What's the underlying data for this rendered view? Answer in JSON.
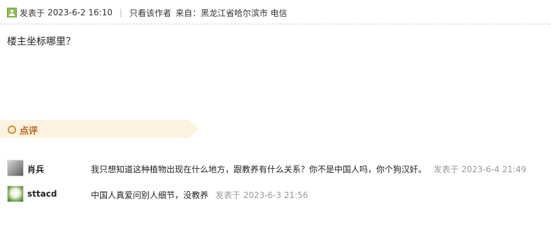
{
  "post": {
    "posted_label": "发表于",
    "date": "2023-6-2 16:10",
    "separator": "|",
    "only_author": "只看该作者",
    "from_label": "来自：",
    "location": "黑龙江省哈尔滨市 电信",
    "body": "楼主坐标哪里？"
  },
  "comments_section": {
    "title": "点评",
    "items": [
      {
        "user": "肖兵",
        "text": "我只想知道这种植物出现在什么地方，跟教养有什么关系？你不是中国人吗，你个狗汉奸。",
        "time": "发表于 2023-6-4 21:49"
      },
      {
        "user": "sttacd",
        "text": "中国人真爱问别人细节，没教养",
        "time": "发表于 2023-6-3 21:56"
      }
    ]
  },
  "colors": {
    "header_bg": "#fdf3e1",
    "accent": "#d98a2b",
    "online_icon": "#8cc152"
  }
}
